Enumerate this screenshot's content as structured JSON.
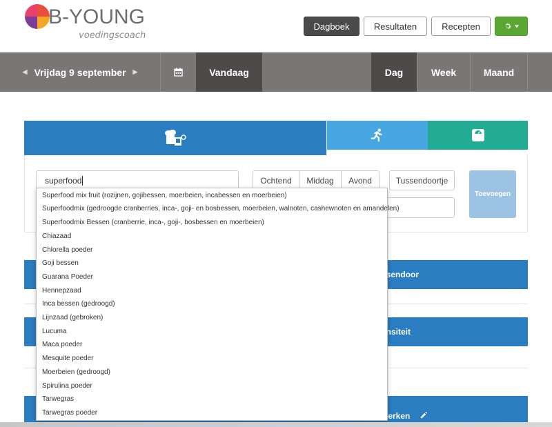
{
  "brand": {
    "name": "B-YOUNG",
    "tagline": "voedingscoach"
  },
  "topnav": [
    {
      "label": "Dagboek",
      "active": true
    },
    {
      "label": "Resultaten",
      "active": false
    },
    {
      "label": "Recepten",
      "active": false
    }
  ],
  "datebar": {
    "date": "Vrijdag 9 september",
    "today": "Vandaag",
    "views": [
      "Dag",
      "Week",
      "Maand"
    ],
    "active_view": "Dag"
  },
  "form": {
    "search_value": "superfood",
    "meals": [
      "Ochtend",
      "Middag",
      "Avond"
    ],
    "snack": "Tussendoortje",
    "add_label": "Toevoegen"
  },
  "sections": {
    "bar1": "ssendoor",
    "bar2": "ensiteit",
    "bar3": "werken"
  },
  "suggestions": [
    "Superfood mix fruit (rozijnen, gojibessen, moerbeien, incabessen en moerbeien)",
    "Superfoodmix (gedroogde cranberries, inca-, goji- en bosbessen, moerbeien, walnoten, cashewnoten en amandelen)",
    "Superfoodmix Bessen (cranberrie, inca-, goji-, bosbessen en moerbeien)",
    "Chiazaad",
    "Chlorella poeder",
    "Goji bessen",
    "Guarana Poeder",
    "Hennepzaad",
    "Inca bessen (gedroogd)",
    "Lijnzaad (gebroken)",
    "Lucuma",
    "Maca poeder",
    "Mesquite poeder",
    "Moerbeien (gedroogd)",
    "Spirulina poeder",
    "Tarwegras",
    "Tarwegras poeder"
  ],
  "colors": {
    "primary": "#2a7dc0",
    "light_blue": "#46a7e3",
    "teal": "#22ac93",
    "green": "#5aa833",
    "datebar": "#797675"
  },
  "icons": [
    "caret-left-icon",
    "caret-right-icon",
    "calendar-icon",
    "gear-icon",
    "caret-down-icon",
    "food-icon",
    "runner-icon",
    "scale-icon",
    "pencil-icon"
  ]
}
